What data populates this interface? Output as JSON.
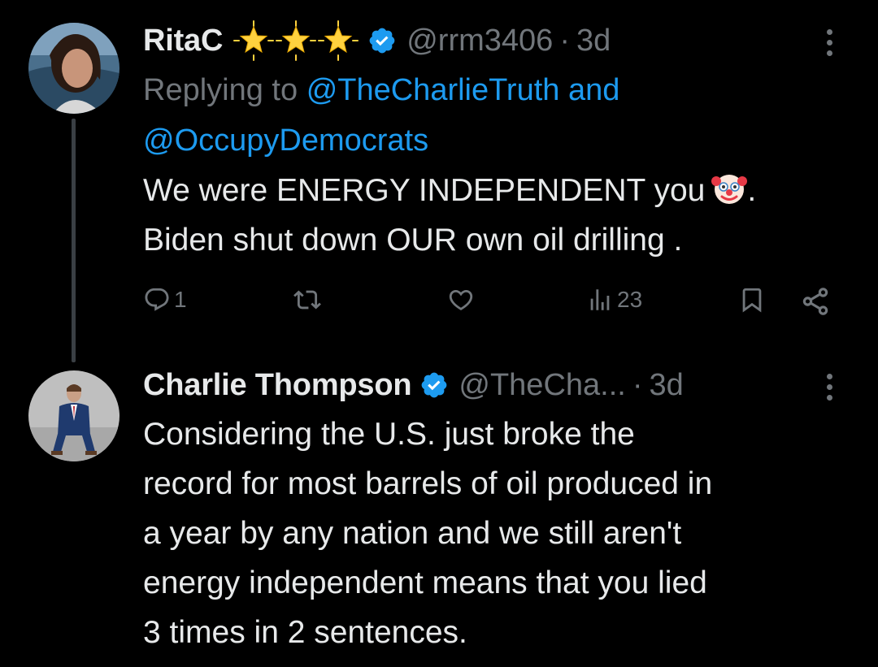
{
  "tweets": [
    {
      "name": "RitaC",
      "handle": "@rrm3406",
      "separator": "·",
      "time": "3d",
      "replying_prefix": "Replying to",
      "reply_mention_1": "@TheCharlieTruth",
      "reply_and": "and",
      "reply_mention_2": "@OccupyDemocrats",
      "text_line_1": "We were ENERGY INDEPENDENT you",
      "text_line_1_after_emoji": ".",
      "emoji": "clown-face-emoji",
      "text_line_2": "Biden shut down OUR own oil drilling .",
      "reply_count": "1",
      "retweet_count": "",
      "like_count": "",
      "view_count": "23"
    },
    {
      "name": "Charlie Thompson",
      "handle": "@TheCha...",
      "separator": "·",
      "time": "3d",
      "text_lines": [
        "Considering the U.S. just broke the",
        "record for most barrels of oil produced in",
        "a year by any nation and we still aren't",
        "energy independent means that you lied",
        "3 times in 2 sentences."
      ]
    }
  ],
  "icons": {
    "reply": "reply-icon",
    "retweet": "retweet-icon",
    "like": "heart-icon",
    "views": "views-bar-icon",
    "bookmark": "bookmark-icon",
    "share": "share-icon",
    "verified": "verified-badge-icon",
    "more": "more-vertical-icon",
    "star": "glowing-star-icon"
  },
  "colors": {
    "background": "#000000",
    "text": "#e7e9ea",
    "muted": "#71767b",
    "accent": "#1d9bf0",
    "star": "#ffd23f"
  }
}
